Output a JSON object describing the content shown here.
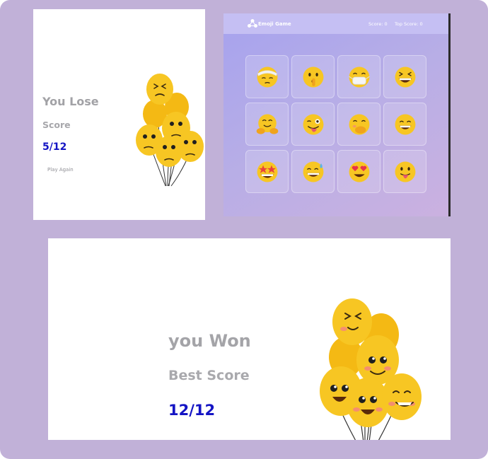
{
  "lose_screen": {
    "title": "You Lose",
    "score_label": "Score",
    "score_value": "5/12",
    "play_again_label": "Play Again"
  },
  "game_screen": {
    "app_title": "Emoji Game",
    "score": "Score: 0",
    "top_score": "Top Score: 0",
    "emoji_cards": [
      {
        "name": "face-with-head-bandage"
      },
      {
        "name": "shushing-face"
      },
      {
        "name": "face-with-medical-mask"
      },
      {
        "name": "grinning-squinting-face"
      },
      {
        "name": "hugging-face"
      },
      {
        "name": "winking-face-with-tongue"
      },
      {
        "name": "face-with-hand-over-mouth"
      },
      {
        "name": "grinning-face-with-smiling-eyes"
      },
      {
        "name": "star-struck"
      },
      {
        "name": "grinning-face-with-sweat"
      },
      {
        "name": "smiling-face-with-heart-eyes"
      },
      {
        "name": "face-with-tongue"
      }
    ]
  },
  "won_screen": {
    "title": "you Won",
    "best_score_label": "Best Score",
    "best_score_value": "12/12"
  },
  "colors": {
    "frame_background": "#c1b1d8",
    "score_blue": "#1414c4",
    "heading_grey": "#a4a4a8",
    "balloon_yellow": "#f7c623"
  }
}
